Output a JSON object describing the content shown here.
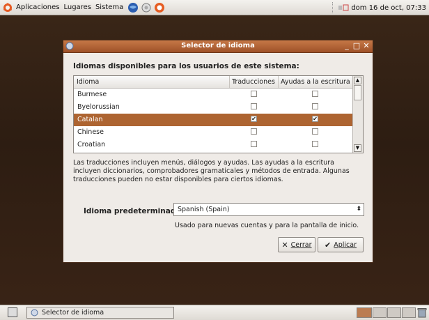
{
  "top_panel": {
    "menus": [
      "Aplicaciones",
      "Lugares",
      "Sistema"
    ],
    "clock": "dom 16 de oct, 07:33"
  },
  "window": {
    "title": "Selector de idioma",
    "heading": "Idiomas disponibles para los usuarios de este sistema:",
    "columns": [
      "Idioma",
      "Traducciones",
      "Ayudas a la escritura"
    ],
    "rows": [
      {
        "language": "Burmese",
        "translations": false,
        "writing_aids": false,
        "selected": false
      },
      {
        "language": "Byelorussian",
        "translations": false,
        "writing_aids": false,
        "selected": false
      },
      {
        "language": "Catalan",
        "translations": true,
        "writing_aids": true,
        "selected": true
      },
      {
        "language": "Chinese",
        "translations": false,
        "writing_aids": false,
        "selected": false
      },
      {
        "language": "Croatian",
        "translations": false,
        "writing_aids": false,
        "selected": false
      }
    ],
    "description": "Las traducciones incluyen menús, diálogos y ayudas. Las ayudas a la escritura incluyen diccionarios, comprobadores gramaticales y métodos de entrada. Algunas traducciones pueden no estar disponibles para ciertos idiomas.",
    "default_label": "Idioma predeterminado:",
    "default_value": "Spanish (Spain)",
    "default_hint": "Usado para nuevas cuentas y para la pantalla de inicio.",
    "close_label": "Cerrar",
    "apply_label": "Aplicar"
  },
  "bottom_panel": {
    "task_label": "Selector de idioma"
  },
  "colors": {
    "titlebar": "#b5643a",
    "selection": "#ad6431",
    "desktop": "#3b2718",
    "active_workspace": "#bb7c52"
  }
}
